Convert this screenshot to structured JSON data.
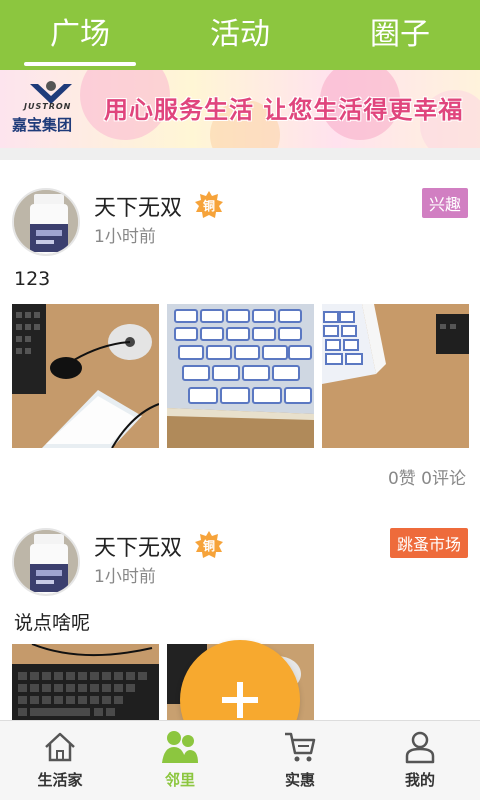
{
  "top_tabs": [
    {
      "label": "广场",
      "active": true
    },
    {
      "label": "活动",
      "active": false
    },
    {
      "label": "圈子",
      "active": false
    }
  ],
  "banner": {
    "logo_en": "JUSTRON",
    "logo_cn": "嘉宝集团",
    "slogan": "用心服务生活  让您生活得更幸福"
  },
  "posts": [
    {
      "user": "天下无双",
      "level_badge": "铜",
      "time": "1小时前",
      "tag": "兴趣",
      "text": "123",
      "images": [
        "keyboard-mouse-photo",
        "label-stickers-photo",
        "label-sheet-photo"
      ],
      "stats": "0赞  0评论"
    },
    {
      "user": "天下无双",
      "level_badge": "铜",
      "time": "1小时前",
      "tag": "跳蚤市场",
      "text": "说点啥呢",
      "images": [
        "keyboard-photo",
        "desk-photo"
      ]
    }
  ],
  "bottom_nav": [
    {
      "label": "生活家",
      "icon": "home-icon",
      "active": false
    },
    {
      "label": "邻里",
      "icon": "people-icon",
      "active": true
    },
    {
      "label": "实惠",
      "icon": "cart-icon",
      "active": false
    },
    {
      "label": "我的",
      "icon": "user-icon",
      "active": false
    }
  ],
  "colors": {
    "primary_green": "#8cc63f",
    "fab_orange": "#f7a92f",
    "tag_interest": "#d17fc2",
    "tag_market": "#ee6b3b",
    "slogan_pink": "#e0457d"
  }
}
